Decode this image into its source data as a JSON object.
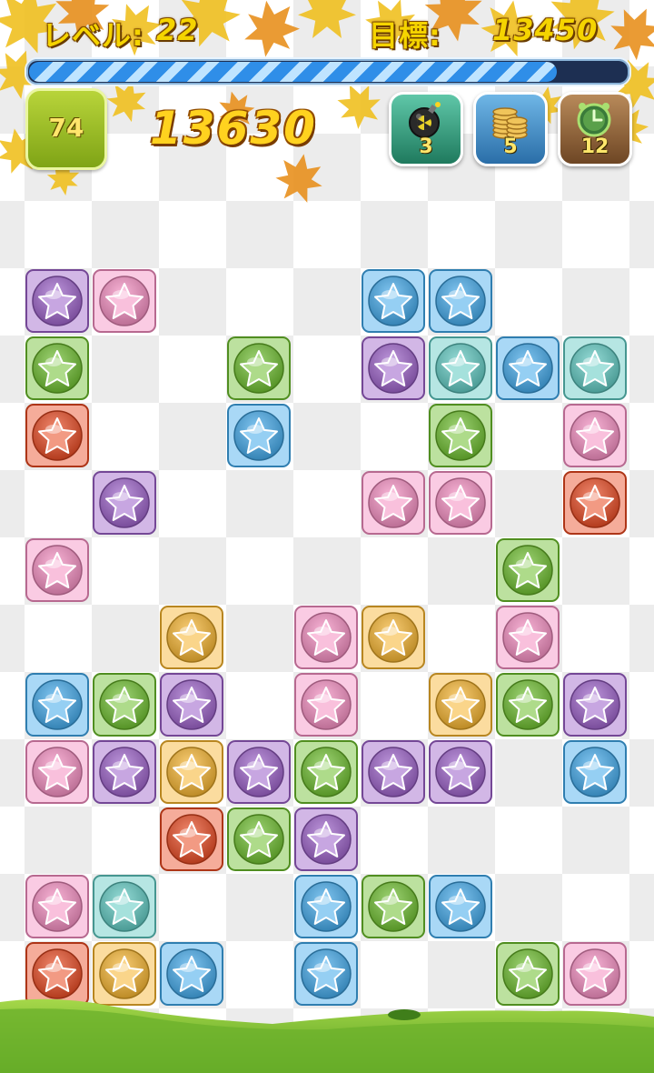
{
  "header": {
    "level_label": "レベル:",
    "level_value": "22",
    "target_label": "目標:",
    "target_value": "13450",
    "progress_fraction": 0.88
  },
  "moves": "74",
  "score": "13630",
  "powerups": [
    {
      "name": "bomb",
      "icon": "bomb-icon",
      "count": "3"
    },
    {
      "name": "coins",
      "icon": "coins-icon",
      "count": "5"
    },
    {
      "name": "clock",
      "icon": "clock-icon",
      "count": "12"
    }
  ],
  "colors": {
    "purple": "#9a5ec8",
    "pink": "#f48cc0",
    "blue": "#3fa8ea",
    "teal": "#5cc8c0",
    "green": "#6bbd2a",
    "red": "#e8471e",
    "orange": "#f5b22a",
    "leaf_yellow": "#f0c020",
    "leaf_orange": "#e8901e",
    "grass": "#86c432"
  },
  "board": {
    "cols": 9,
    "rows": 11,
    "cells": [
      [
        "purple",
        "pink",
        null,
        null,
        null,
        "blue",
        "blue",
        null,
        null
      ],
      [
        "green",
        null,
        null,
        "green",
        null,
        "purple",
        "teal",
        "blue",
        "teal"
      ],
      [
        "red",
        null,
        null,
        "blue",
        null,
        null,
        "green",
        null,
        "pink"
      ],
      [
        null,
        "purple",
        null,
        null,
        null,
        "pink",
        "pink",
        null,
        "red"
      ],
      [
        "pink",
        null,
        null,
        null,
        null,
        null,
        null,
        "green",
        null
      ],
      [
        null,
        null,
        "orange",
        null,
        "pink",
        "orange",
        null,
        "pink",
        null
      ],
      [
        "blue",
        "green",
        "purple",
        null,
        "pink",
        null,
        "orange",
        "green",
        "purple"
      ],
      [
        "pink",
        "purple",
        "orange",
        "purple",
        "green",
        "purple",
        "purple",
        null,
        "blue"
      ],
      [
        null,
        null,
        "red",
        "green",
        "purple",
        null,
        null,
        null,
        null
      ],
      [
        "pink",
        "teal",
        null,
        null,
        "blue",
        "green",
        "blue",
        null,
        null
      ],
      [
        "red",
        "orange",
        "blue",
        null,
        "blue",
        null,
        null,
        "green",
        "pink"
      ]
    ]
  }
}
